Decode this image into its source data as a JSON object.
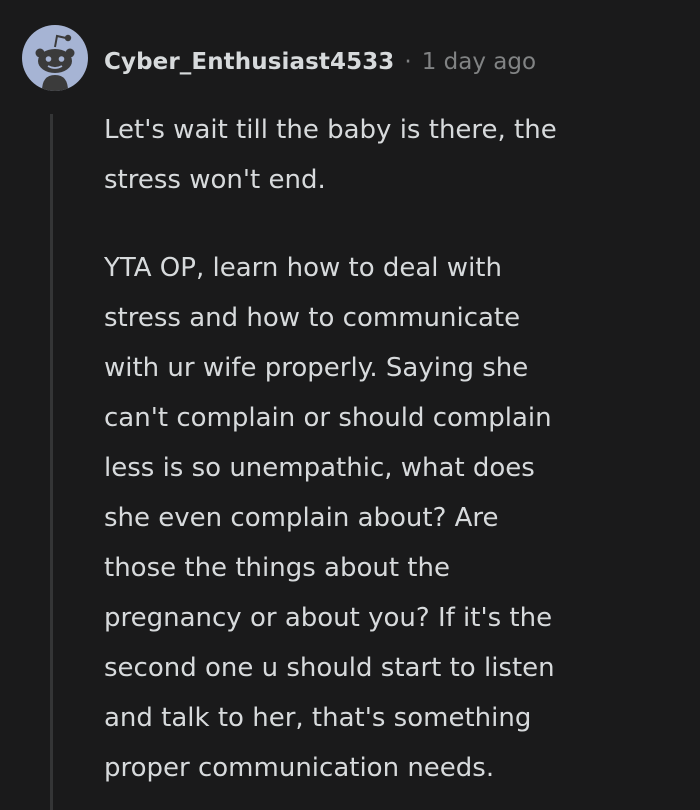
{
  "comment": {
    "author": "Cyber_Enthusiast4533",
    "separator": "·",
    "timestamp": "1 day ago",
    "avatar": {
      "icon": "reddit-snoo-icon",
      "background": "#a6b4d4"
    },
    "paragraphs": [
      "Let's wait till the baby is there, the\nstress won't end.",
      "YTA OP, learn how to deal with\nstress and how to communicate\nwith ur wife properly. Saying she\ncan't complain or should complain\nless is so unempathic, what does\nshe even complain about? Are\nthose the things about the\npregnancy or about you? If it's the\nsecond one u should start to listen\nand talk to her, that's something\nproper communication needs."
    ]
  },
  "colors": {
    "background": "#1a1a1b",
    "text": "#d7dadc",
    "meta": "#818384",
    "thread_line": "#343536"
  }
}
